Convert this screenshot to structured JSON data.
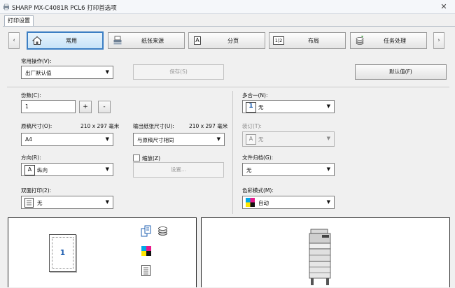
{
  "window": {
    "title": "SHARP MX-C4081R PCL6 打印首选项",
    "close_glyph": "✕"
  },
  "tabs": [
    {
      "label": "打印设置"
    }
  ],
  "nav": {
    "prev": "‹",
    "next": "›",
    "items": [
      {
        "label": "常用",
        "icon": "home-icon",
        "active": true
      },
      {
        "label": "纸张来源",
        "icon": "paper-tray-icon"
      },
      {
        "label": "分页",
        "icon": "page-icon",
        "icon_text": "A"
      },
      {
        "label": "布局",
        "icon": "layout-icon",
        "icon_text": "1|2"
      },
      {
        "label": "任务处理",
        "icon": "job-stack-icon"
      }
    ]
  },
  "common_ops": {
    "label": "常用操作(V):",
    "value": "出厂默认值",
    "save_label": "保存(S)",
    "default_label": "默认值(F)"
  },
  "copies": {
    "label": "份数(C):",
    "value": "1",
    "plus": "+",
    "minus": "-"
  },
  "original_size": {
    "label": "原稿尺寸(O):",
    "dims": "210 x 297 毫米",
    "value": "A4"
  },
  "output_size": {
    "label": "输出纸张尺寸(U):",
    "dims": "210 x 297 毫米",
    "value": "与原稿尺寸相同"
  },
  "orientation": {
    "label": "方向(R):",
    "value": "纵向",
    "icon_text": "A"
  },
  "zoom": {
    "label": "缩放(Z)",
    "settings_label": "设置..."
  },
  "duplex": {
    "label": "双面打印(2):",
    "value": "无"
  },
  "nup": {
    "label": "多合一(N):",
    "value": "无",
    "icon_text": "1"
  },
  "binding": {
    "label": "装订(T):",
    "value": "无",
    "icon_text": "A"
  },
  "filing": {
    "label": "文件归档(G):",
    "value": "无"
  },
  "color_mode": {
    "label": "色彩模式(M):",
    "value": "自动"
  },
  "preview": {
    "page_number": "1"
  },
  "colors": {
    "accent": "#3c7fc4",
    "nup_blue": "#1f5fb0"
  }
}
